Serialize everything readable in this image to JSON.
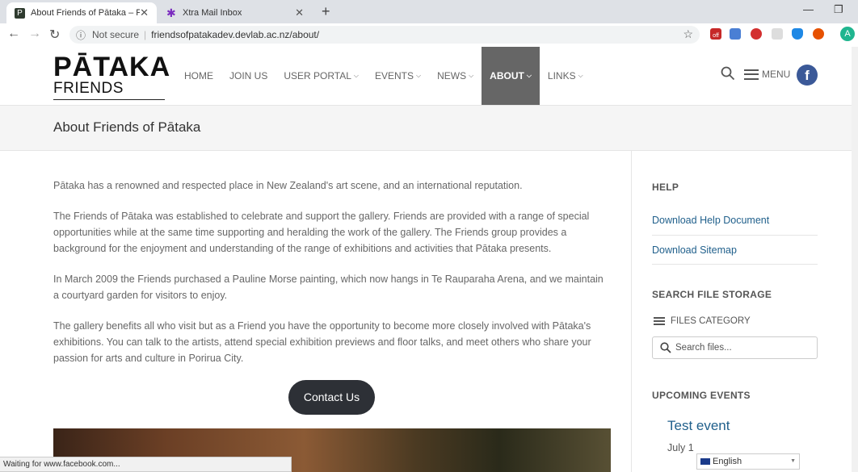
{
  "browser": {
    "tabs": [
      {
        "title": "About Friends of Pātaka – Friend",
        "active": true,
        "icon": "pataka-favicon"
      },
      {
        "title": "Xtra Mail Inbox",
        "active": false,
        "icon": "xtra-star-favicon"
      }
    ],
    "new_tab": "+",
    "window_controls": {
      "minimize": "—",
      "restore": "❐"
    },
    "not_secure": "Not secure",
    "url": "friendsofpatakadev.devlab.ac.nz/about/",
    "profile_initial": "A",
    "extension_badge": "off"
  },
  "site": {
    "logo": {
      "top": "PĀTAKA",
      "bottom": "FRIENDS"
    },
    "nav": [
      {
        "label": "HOME",
        "dropdown": false
      },
      {
        "label": "JOIN US",
        "dropdown": false
      },
      {
        "label": "USER PORTAL",
        "dropdown": true
      },
      {
        "label": "EVENTS",
        "dropdown": true
      },
      {
        "label": "NEWS",
        "dropdown": true
      },
      {
        "label": "ABOUT",
        "dropdown": true,
        "active": true
      },
      {
        "label": "LINKS",
        "dropdown": true
      }
    ],
    "menu_label": "MENU",
    "facebook": "f"
  },
  "page": {
    "title": "About Friends of Pātaka",
    "paragraphs": [
      "Pātaka has a renowned and respected place in New Zealand's art scene, and an international reputation.",
      "The Friends of Pātaka was established to celebrate and support the gallery. Friends are provided with a range of special opportunities while at the same time supporting and heralding the work of the gallery. The Friends group provides a background for the enjoyment and understanding of the range of exhibitions and activities that Pātaka presents.",
      "In March 2009 the Friends purchased a Pauline Morse painting, which now hangs in Te Rauparaha Arena, and we maintain a courtyard garden for visitors to enjoy.",
      "The gallery benefits all who visit but as a Friend you have the opportunity to become more closely involved with Pātaka's exhibitions. You can talk to the artists, attend special exhibition previews and floor talks, and meet others who share your passion for arts and culture in Porirua City."
    ],
    "contact_button": "Contact Us"
  },
  "sidebar": {
    "help_heading": "HELP",
    "help_links": [
      "Download Help Document",
      "Download Sitemap"
    ],
    "search_heading": "SEARCH FILE STORAGE",
    "files_category": "FILES CATEGORY",
    "search_placeholder": "Search files...",
    "events_heading": "UPCOMING EVENTS",
    "event": {
      "title": "Test event",
      "date": "July 1"
    }
  },
  "language": "English",
  "status_text": "Waiting for www.facebook.com..."
}
